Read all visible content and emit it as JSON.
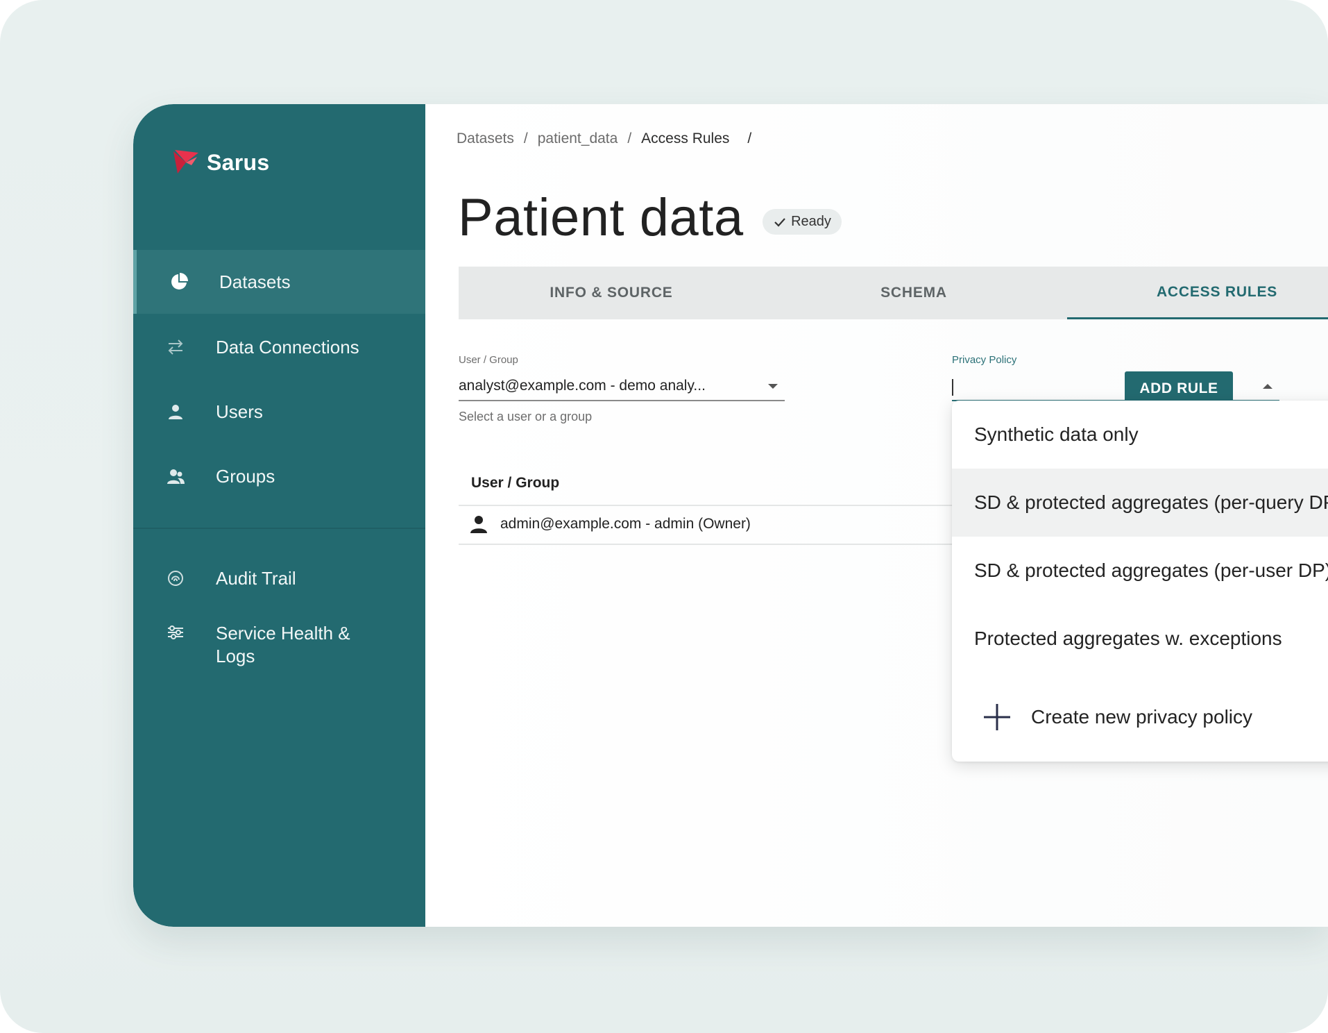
{
  "app": {
    "name": "Sarus"
  },
  "sidebar": {
    "items": [
      {
        "label": "Datasets",
        "icon": "pie-chart-icon",
        "active": true
      },
      {
        "label": "Data Connections",
        "icon": "swap-arrows-icon",
        "active": false
      },
      {
        "label": "Users",
        "icon": "user-icon",
        "active": false
      },
      {
        "label": "Groups",
        "icon": "group-icon",
        "active": false
      },
      {
        "label": "Audit Trail",
        "icon": "fingerprint-icon",
        "active": false
      },
      {
        "label": "Service Health & Logs",
        "icon": "sliders-icon",
        "active": false
      }
    ]
  },
  "breadcrumb": {
    "items": [
      "Datasets",
      "patient_data",
      "Access Rules"
    ],
    "sep": "/"
  },
  "page": {
    "title": "Patient data",
    "status": "Ready"
  },
  "tabs": [
    {
      "label": "INFO & SOURCE",
      "active": false
    },
    {
      "label": "SCHEMA",
      "active": false
    },
    {
      "label": "ACCESS RULES",
      "active": true
    }
  ],
  "form": {
    "user_group": {
      "label": "User / Group",
      "value": "analyst@example.com - demo analy...",
      "helper": "Select a user or a group"
    },
    "privacy_policy": {
      "label": "Privacy Policy",
      "value": ""
    },
    "add_rule": "ADD RULE"
  },
  "table": {
    "header": "User / Group",
    "rows": [
      {
        "user": "admin@example.com - admin (Owner)"
      }
    ]
  },
  "dropdown": {
    "options": [
      "Synthetic data only",
      "SD & protected aggregates (per-query DP)",
      "SD & protected aggregates (per-user DP)",
      "Protected aggregates w. exceptions"
    ],
    "highlighted_index": 1,
    "create": "Create new privacy policy"
  },
  "colors": {
    "sidebar": "#236a70",
    "accent": "#236a70",
    "logo": "#e8324d"
  }
}
